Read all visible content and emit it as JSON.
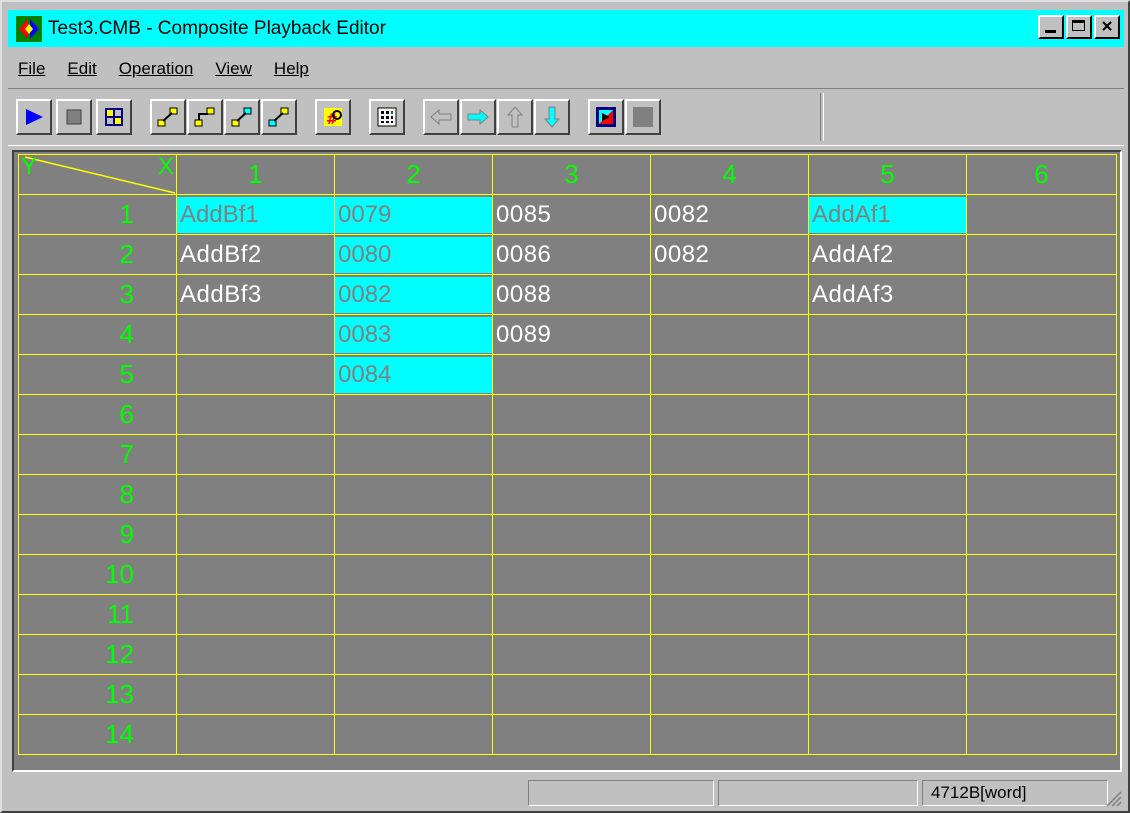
{
  "window": {
    "title": "Test3.CMB - Composite Playback Editor",
    "title_color": "#00ffff"
  },
  "menu": [
    {
      "label": "File"
    },
    {
      "label": "Edit"
    },
    {
      "label": "Operation"
    },
    {
      "label": "View"
    },
    {
      "label": "Help"
    }
  ],
  "toolbar": {
    "buttons": [
      {
        "icon": "play-icon"
      },
      {
        "icon": "stop-icon"
      },
      {
        "icon": "grid-layout-icon"
      },
      {
        "icon": "link-icon-1"
      },
      {
        "icon": "link-icon-2"
      },
      {
        "icon": "link-icon-3"
      },
      {
        "icon": "link-icon-4"
      },
      {
        "icon": "renumber-icon"
      },
      {
        "icon": "matrix-icon"
      },
      {
        "icon": "arrow-left-icon"
      },
      {
        "icon": "arrow-right-icon"
      },
      {
        "icon": "arrow-up-icon"
      },
      {
        "icon": "arrow-down-icon"
      },
      {
        "icon": "color-box-icon"
      },
      {
        "icon": "blank-button-icon"
      }
    ]
  },
  "grid": {
    "corner_y": "Y",
    "corner_x": "X",
    "columns": [
      "1",
      "2",
      "3",
      "4",
      "5",
      "6"
    ],
    "rows": [
      {
        "label": "1",
        "cells": [
          "AddBf1",
          "0079",
          "0085",
          "0082",
          "AddAf1",
          ""
        ]
      },
      {
        "label": "2",
        "cells": [
          "AddBf2",
          "0080",
          "0086",
          "0082",
          "AddAf2",
          ""
        ]
      },
      {
        "label": "3",
        "cells": [
          "AddBf3",
          "0082",
          "0088",
          "",
          "AddAf3",
          ""
        ]
      },
      {
        "label": "4",
        "cells": [
          "",
          "0083",
          "0089",
          "",
          "",
          ""
        ]
      },
      {
        "label": "5",
        "cells": [
          "",
          "0084",
          "",
          "",
          "",
          ""
        ]
      },
      {
        "label": "6",
        "cells": [
          "",
          "",
          "",
          "",
          "",
          ""
        ]
      },
      {
        "label": "7",
        "cells": [
          "",
          "",
          "",
          "",
          "",
          ""
        ]
      },
      {
        "label": "8",
        "cells": [
          "",
          "",
          "",
          "",
          "",
          ""
        ]
      },
      {
        "label": "9",
        "cells": [
          "",
          "",
          "",
          "",
          "",
          ""
        ]
      },
      {
        "label": "10",
        "cells": [
          "",
          "",
          "",
          "",
          "",
          ""
        ]
      },
      {
        "label": "11",
        "cells": [
          "",
          "",
          "",
          "",
          "",
          ""
        ]
      },
      {
        "label": "12",
        "cells": [
          "",
          "",
          "",
          "",
          "",
          ""
        ]
      },
      {
        "label": "13",
        "cells": [
          "",
          "",
          "",
          "",
          "",
          ""
        ]
      },
      {
        "label": "14",
        "cells": [
          "",
          "",
          "",
          "",
          "",
          ""
        ]
      }
    ],
    "highlighted": [
      [
        0,
        0
      ],
      [
        0,
        1
      ],
      [
        1,
        1
      ],
      [
        2,
        1
      ],
      [
        3,
        1
      ],
      [
        4,
        1
      ],
      [
        0,
        4
      ]
    ],
    "colors": {
      "grid_bg": "#808080",
      "grid_line": "#ffff00",
      "header_text": "#00ff00",
      "highlight": "#00ffff"
    }
  },
  "statusbar": {
    "pane1": "",
    "pane2": "",
    "pane3": "4712B[word]"
  }
}
